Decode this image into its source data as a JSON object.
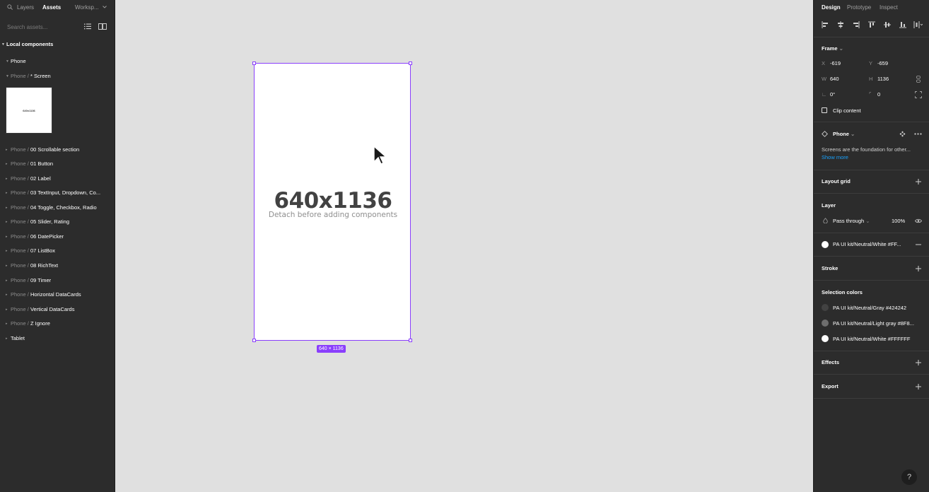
{
  "left_panel": {
    "tabs": {
      "layers": "Layers",
      "assets": "Assets",
      "workspace": "Worksp..."
    },
    "search": {
      "placeholder": "Search assets..."
    },
    "section_title": "Local components",
    "items": [
      {
        "label": "Phone",
        "prefix": ""
      },
      {
        "prefix": "Phone / ",
        "label": "* Screen"
      },
      {
        "prefix": "Phone / ",
        "label": "00 Scrollable section"
      },
      {
        "prefix": "Phone / ",
        "label": "01 Button"
      },
      {
        "prefix": "Phone / ",
        "label": "02 Label"
      },
      {
        "prefix": "Phone / ",
        "label": "03 TextInput, Dropdown, Co..."
      },
      {
        "prefix": "Phone / ",
        "label": "04 Toggle, Checkbox, Radio"
      },
      {
        "prefix": "Phone / ",
        "label": "05 Slider, Rating"
      },
      {
        "prefix": "Phone / ",
        "label": "06 DatePicker"
      },
      {
        "prefix": "Phone / ",
        "label": "07 ListBox"
      },
      {
        "prefix": "Phone / ",
        "label": "08 RichText"
      },
      {
        "prefix": "Phone / ",
        "label": "09 Timer"
      },
      {
        "prefix": "Phone / ",
        "label": "Horizontal DataCards"
      },
      {
        "prefix": "Phone / ",
        "label": "Vertical DataCards"
      },
      {
        "prefix": "Phone / ",
        "label": "Z Ignore"
      },
      {
        "prefix": "",
        "label": "Tablet"
      }
    ],
    "thumbnail_text": "640x1136"
  },
  "canvas": {
    "frame_title": "640x1136",
    "frame_subtitle": "Detach before adding components",
    "size_badge": "640 × 1136",
    "accent": "#8a3ffc",
    "frame_fill": "#ffffff",
    "background": "#e0e0e0"
  },
  "right_panel": {
    "tabs": {
      "design": "Design",
      "prototype": "Prototype",
      "inspect": "Inspect"
    },
    "frame_section": "Frame",
    "x": {
      "key": "X",
      "value": "-619"
    },
    "y": {
      "key": "Y",
      "value": "-659"
    },
    "w": {
      "key": "W",
      "value": "640"
    },
    "h": {
      "key": "H",
      "value": "1136"
    },
    "rotation": "0°",
    "radius": "0",
    "clip_content": "Clip content",
    "component": {
      "name": "Phone",
      "description": "Screens are the foundation for other...",
      "show_more": "Show more"
    },
    "layout_grid": "Layout grid",
    "layer": {
      "title": "Layer",
      "blend": "Pass through",
      "opacity": "100%"
    },
    "fill": {
      "label": "PA UI kit/Neutral/White #FF...",
      "color": "#ffffff"
    },
    "stroke": "Stroke",
    "selection_colors": {
      "title": "Selection colors",
      "items": [
        {
          "label": "PA UI kit/Neutral/Gray #424242",
          "color": "#424242"
        },
        {
          "label": "PA UI kit/Neutral/Light gray #8F8...",
          "color": "#8f8f8f"
        },
        {
          "label": "PA UI kit/Neutral/White #FFFFFF",
          "color": "#ffffff"
        }
      ]
    },
    "effects": "Effects",
    "export": "Export",
    "help": "?"
  }
}
